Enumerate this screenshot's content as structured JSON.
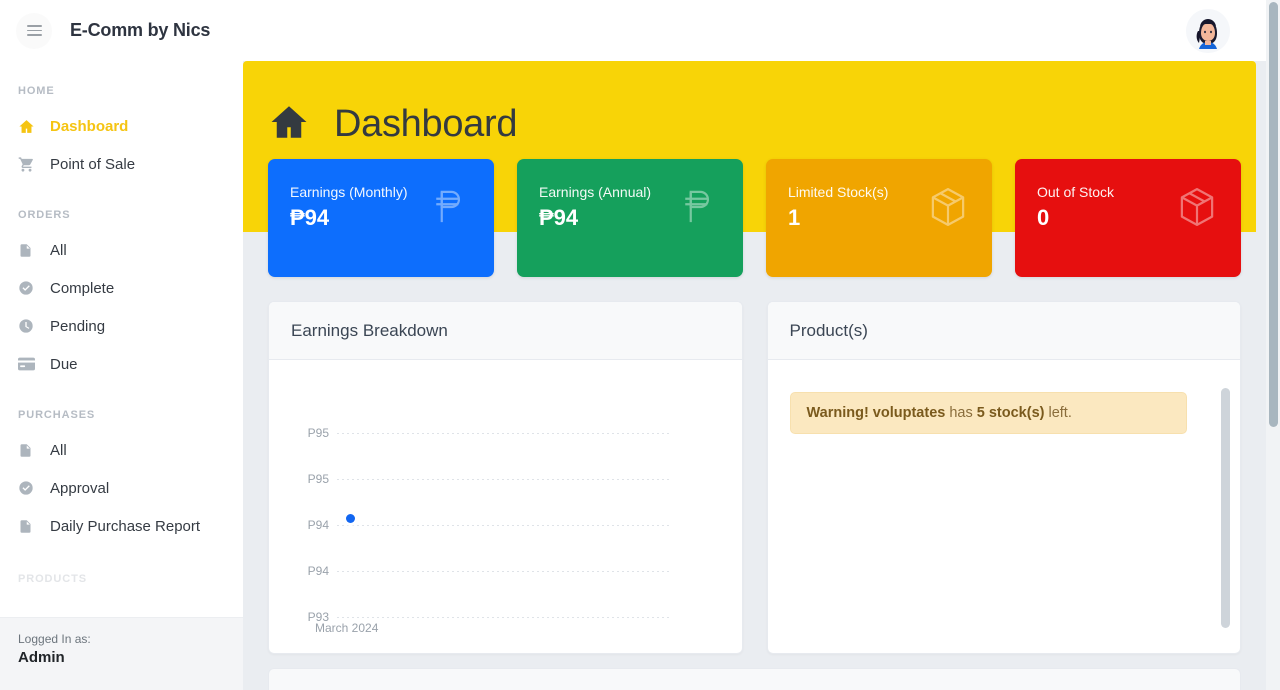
{
  "topbar": {
    "menu_icon": "hamburger-icon",
    "brand": "E-Comm by Nics",
    "avatar_icon": "user-avatar"
  },
  "sidebar": {
    "sections": [
      {
        "label": "HOME",
        "items": [
          {
            "label": "Dashboard",
            "icon": "home-icon",
            "active": true
          },
          {
            "label": "Point of Sale",
            "icon": "cart-icon",
            "active": false
          }
        ]
      },
      {
        "label": "ORDERS",
        "items": [
          {
            "label": "All",
            "icon": "file-icon",
            "active": false
          },
          {
            "label": "Complete",
            "icon": "check-circle-icon",
            "active": false
          },
          {
            "label": "Pending",
            "icon": "clock-icon",
            "active": false
          },
          {
            "label": "Due",
            "icon": "credit-card-icon",
            "active": false
          }
        ]
      },
      {
        "label": "PURCHASES",
        "items": [
          {
            "label": "All",
            "icon": "file-icon",
            "active": false
          },
          {
            "label": "Approval",
            "icon": "check-circle-icon",
            "active": false
          },
          {
            "label": "Daily Purchase Report",
            "icon": "file-icon",
            "active": false
          }
        ]
      },
      {
        "label": "PRODUCTS",
        "items": []
      }
    ],
    "footer": {
      "logged_label": "Logged In as:",
      "user": "Admin"
    }
  },
  "page": {
    "icon": "home-icon",
    "title": "Dashboard",
    "banner_color": "#f8d407"
  },
  "stats": [
    {
      "label": "Earnings (Monthly)",
      "value": "₱94",
      "color": "#0d6efd",
      "icon": "peso-icon"
    },
    {
      "label": "Earnings (Annual)",
      "value": "₱94",
      "color": "#15a05c",
      "icon": "peso-icon"
    },
    {
      "label": "Limited Stock(s)",
      "value": "1",
      "color": "#f0a500",
      "icon": "box-icon"
    },
    {
      "label": "Out of Stock",
      "value": "0",
      "color": "#e60f0f",
      "icon": "box-icon"
    }
  ],
  "earnings_panel": {
    "title": "Earnings Breakdown"
  },
  "products_panel": {
    "title": "Product(s)",
    "alerts": [
      {
        "prefix": "Warning! voluptates",
        "middle": " has ",
        "emphasis": "5 stock(s)",
        "suffix": " left."
      }
    ]
  },
  "chart_data": {
    "type": "line",
    "title": "Earnings Breakdown",
    "xlabel": "",
    "ylabel": "",
    "categories": [
      "March 2024"
    ],
    "x": [
      "March 2024"
    ],
    "series": [
      {
        "name": "Earnings",
        "values": [
          94
        ]
      }
    ],
    "ytick_labels": [
      "P95",
      "P95",
      "P94",
      "P94",
      "P93"
    ],
    "ytick_values": [
      94.5,
      94.25,
      94.0,
      93.75,
      93.5
    ],
    "ylim": [
      93.5,
      94.5
    ],
    "grid": true,
    "grid_style": "dotted-horizontal",
    "legend": false,
    "point_color": "#1266f1",
    "marker_only": true
  }
}
